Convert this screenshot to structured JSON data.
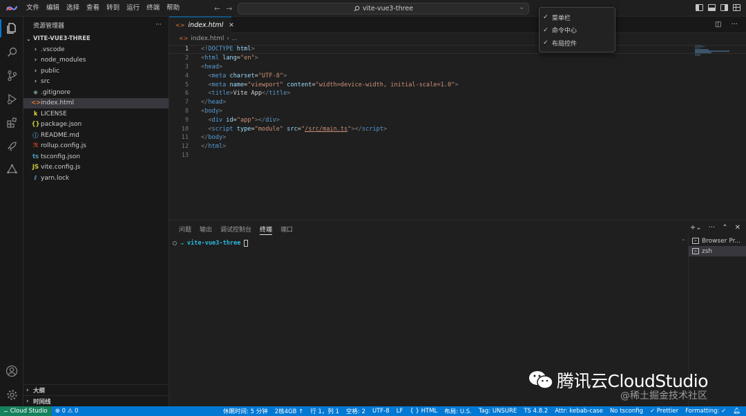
{
  "menu": [
    "文件",
    "编辑",
    "选择",
    "查看",
    "转到",
    "运行",
    "终端",
    "帮助"
  ],
  "command_center": {
    "label": "vite-vue3-three"
  },
  "icons": {
    "back": "arrow-left-icon",
    "forward": "arrow-right-icon",
    "search": "search-icon"
  },
  "dropdown": {
    "items": [
      {
        "check": "✓",
        "label": "菜单栏"
      },
      {
        "check": "✓",
        "label": "命令中心"
      },
      {
        "check": "✓",
        "label": "布局控件"
      }
    ]
  },
  "sidebar": {
    "title": "资源管理器",
    "more": "···",
    "folder": "VITE-VUE3-THREE",
    "items": [
      {
        "icon": "›",
        "label": ".vscode",
        "color": "#cccccc"
      },
      {
        "icon": "›",
        "label": "node_modules",
        "color": "#cccccc"
      },
      {
        "icon": "›",
        "label": "public",
        "color": "#cccccc"
      },
      {
        "icon": "›",
        "label": "src",
        "color": "#cccccc"
      },
      {
        "icon": "◆",
        "label": ".gitignore",
        "color": "#6d8086"
      },
      {
        "icon": "<>",
        "label": "index.html",
        "color": "#e37933"
      },
      {
        "icon": "𝐤",
        "label": "LICENSE",
        "color": "#cbcb41"
      },
      {
        "icon": "{}",
        "label": "package.json",
        "color": "#cbcb41"
      },
      {
        "icon": "ⓘ",
        "label": "README.md",
        "color": "#519aba"
      },
      {
        "icon": "ℛ",
        "label": "rollup.config.js",
        "color": "#e44d26"
      },
      {
        "icon": "ts",
        "label": "tsconfig.json",
        "color": "#519aba"
      },
      {
        "icon": "JS",
        "label": "vite.config.js",
        "color": "#cbcb41"
      },
      {
        "icon": "ℓ",
        "label": "yarn.lock",
        "color": "#519aba"
      }
    ],
    "outline": "大纲",
    "timeline": "时间线"
  },
  "editor": {
    "tab": {
      "icon": "<>",
      "label": "index.html",
      "close": "✕"
    },
    "breadcrumb": {
      "file": "index.html",
      "sep": "› ..."
    },
    "lines": [
      {
        "n": "1"
      },
      {
        "n": "2"
      },
      {
        "n": "3"
      },
      {
        "n": "4"
      },
      {
        "n": "5"
      },
      {
        "n": "6"
      },
      {
        "n": "7"
      },
      {
        "n": "8"
      },
      {
        "n": "9"
      },
      {
        "n": "10"
      },
      {
        "n": "11"
      },
      {
        "n": "12"
      },
      {
        "n": "13"
      }
    ]
  },
  "panel": {
    "tabs": [
      "问题",
      "输出",
      "调试控制台",
      "终端",
      "端口"
    ],
    "active_tab": "终端",
    "terminal": {
      "prompt_arrow": "→",
      "dir": "vite-vue3-three"
    },
    "terminals": [
      {
        "label": "Browser Pr..."
      },
      {
        "label": "zsh"
      }
    ]
  },
  "statusbar": {
    "remote": "Cloud Studio",
    "errors": "⊗ 0 ⚠ 0",
    "items": [
      "休眠时间: 5 分钟",
      "2核4GB ↑",
      "行 1，列 1",
      "空格: 2",
      "UTF-8",
      "LF",
      "{ } HTML",
      "布局: U.S.",
      "Tag: UNSURE",
      "TS 4.8.2",
      "Attr: kebab-case",
      "No tsconfig",
      "✓ Prettier",
      "Formatting: ✓"
    ]
  },
  "watermark": {
    "title": "腾讯云CloudStudio",
    "sub": "@稀土掘金技术社区"
  },
  "colors": {
    "accent": "#0078d4",
    "status_remote": "#16825d"
  }
}
